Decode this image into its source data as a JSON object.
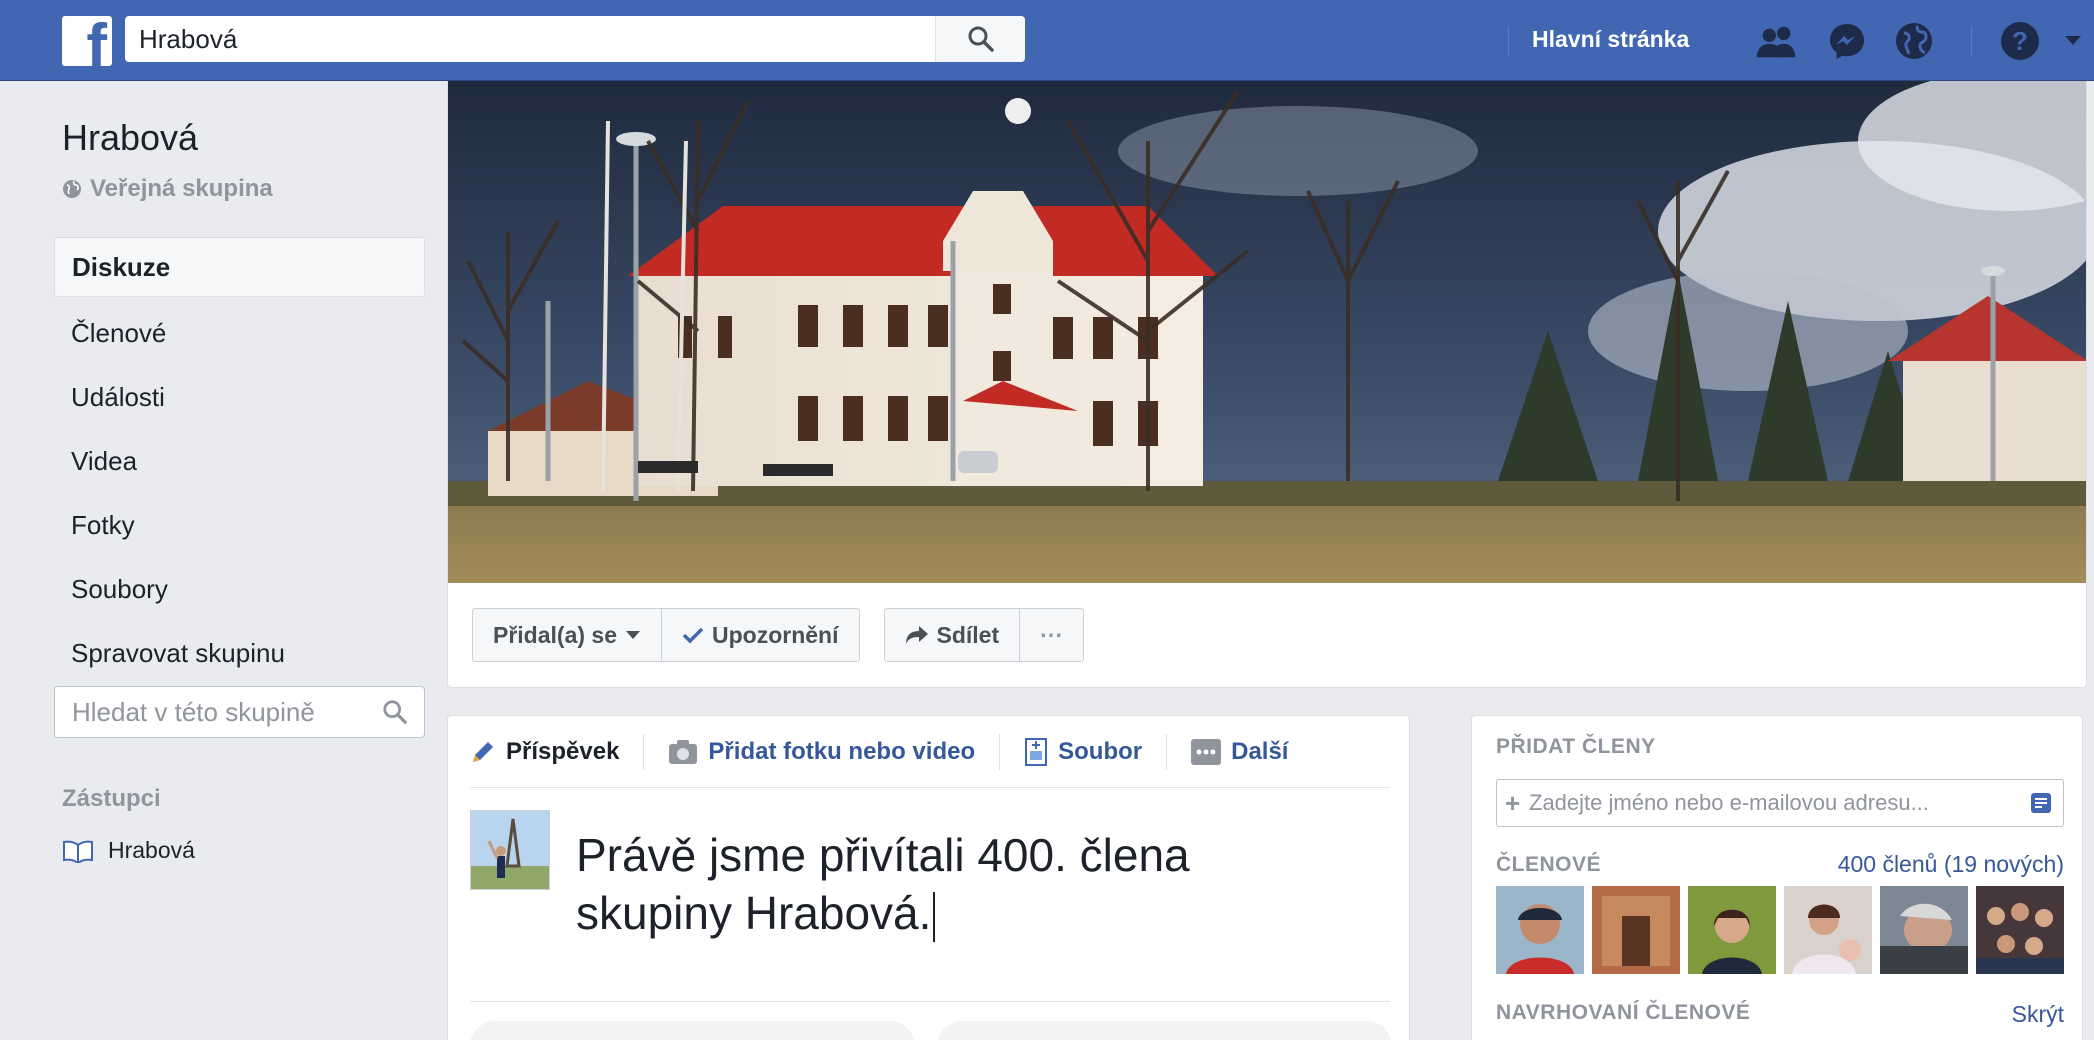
{
  "topbar": {
    "logo_letter": "f",
    "search_value": "Hrabová",
    "home_label": "Hlavní stránka",
    "icons": [
      "friend-requests-icon",
      "messenger-icon",
      "notifications-globe-icon",
      "help-icon",
      "account-menu-icon"
    ]
  },
  "group": {
    "name": "Hrabová",
    "type": "Veřejná skupina"
  },
  "nav": {
    "items": [
      {
        "label": "Diskuze",
        "active": true
      },
      {
        "label": "Členové"
      },
      {
        "label": "Události"
      },
      {
        "label": "Videa"
      },
      {
        "label": "Fotky"
      },
      {
        "label": "Soubory"
      },
      {
        "label": "Spravovat skupinu"
      }
    ],
    "search_placeholder": "Hledat v této skupině"
  },
  "representatives": {
    "title": "Zástupci",
    "items": [
      {
        "label": "Hrabová"
      }
    ]
  },
  "actions": {
    "joined_label": "Přidal(a) se",
    "notifications_label": "Upozornění",
    "share_label": "Sdílet",
    "more_label": "···"
  },
  "composer": {
    "tabs": [
      {
        "label": "Příspěvek"
      },
      {
        "label": "Přidat fotku nebo video"
      },
      {
        "label": "Soubor"
      },
      {
        "label": "Další"
      }
    ],
    "text_line1": "Právě jsme přivítali 400. člena",
    "text_line2": "skupiny Hrabová."
  },
  "members_panel": {
    "add_title": "PŘIDAT ČLENY",
    "add_placeholder": "Zadejte jméno nebo e-mailovou adresu...",
    "members_label": "ČLENOVÉ",
    "members_count": "400 členů (19 nových)",
    "suggested_label": "NAVRHOVANÍ ČLENOVÉ",
    "hide_label": "Skrýt"
  },
  "colors": {
    "brand": "#4267b2",
    "link": "#365899",
    "muted": "#90949c",
    "background": "#e9ebee"
  }
}
